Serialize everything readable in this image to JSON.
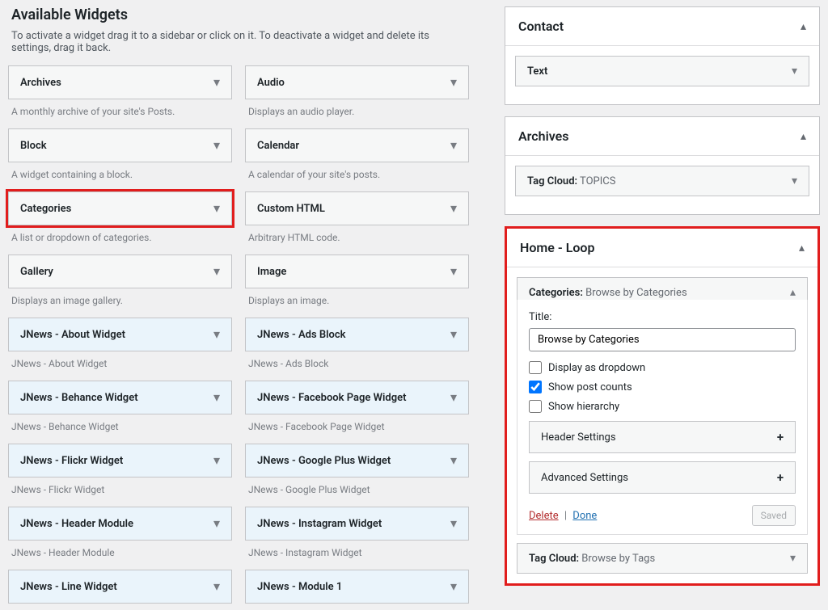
{
  "available": {
    "title": "Available Widgets",
    "desc": "To activate a widget drag it to a sidebar or click on it. To deactivate a widget and delete its settings, drag it back."
  },
  "widgets": {
    "archives": {
      "name": "Archives",
      "desc": "A monthly archive of your site's Posts."
    },
    "audio": {
      "name": "Audio",
      "desc": "Displays an audio player."
    },
    "block": {
      "name": "Block",
      "desc": "A widget containing a block."
    },
    "calendar": {
      "name": "Calendar",
      "desc": "A calendar of your site's posts."
    },
    "categories": {
      "name": "Categories",
      "desc": "A list or dropdown of categories."
    },
    "customhtml": {
      "name": "Custom HTML",
      "desc": "Arbitrary HTML code."
    },
    "gallery": {
      "name": "Gallery",
      "desc": "Displays an image gallery."
    },
    "image": {
      "name": "Image",
      "desc": "Displays an image."
    },
    "jn_about": {
      "name": "JNews - About Widget",
      "desc": "JNews - About Widget"
    },
    "jn_ads": {
      "name": "JNews - Ads Block",
      "desc": "JNews - Ads Block"
    },
    "jn_behance": {
      "name": "JNews - Behance Widget",
      "desc": "JNews - Behance Widget"
    },
    "jn_facebook": {
      "name": "JNews - Facebook Page Widget",
      "desc": "JNews - Facebook Page Widget"
    },
    "jn_flickr": {
      "name": "JNews - Flickr Widget",
      "desc": "JNews - Flickr Widget"
    },
    "jn_gplus": {
      "name": "JNews - Google Plus Widget",
      "desc": "JNews - Google Plus Widget"
    },
    "jn_header": {
      "name": "JNews - Header Module",
      "desc": "JNews - Header Module"
    },
    "jn_instagram": {
      "name": "JNews - Instagram Widget",
      "desc": "JNews - Instagram Widget"
    },
    "jn_line": {
      "name": "JNews - Line Widget",
      "desc": ""
    },
    "jn_mod1": {
      "name": "JNews - Module 1",
      "desc": ""
    }
  },
  "sidebars": {
    "contact": {
      "title": "Contact",
      "item_label": "Text"
    },
    "archives": {
      "title": "Archives",
      "item_label": "Tag Cloud:",
      "item_name": " TOPICS"
    },
    "home_loop": {
      "title": "Home - Loop",
      "cat_label": "Categories:",
      "cat_name": " Browse by Categories",
      "form": {
        "title_label": "Title:",
        "title_value": "Browse by Categories",
        "opt_dropdown": "Display as dropdown",
        "opt_postcounts": "Show post counts",
        "opt_hierarchy": "Show hierarchy",
        "header_settings": "Header Settings",
        "advanced_settings": "Advanced Settings",
        "delete": "Delete",
        "done": "Done",
        "saved": "Saved"
      },
      "tagcloud_label": "Tag Cloud:",
      "tagcloud_name": " Browse by Tags"
    }
  }
}
